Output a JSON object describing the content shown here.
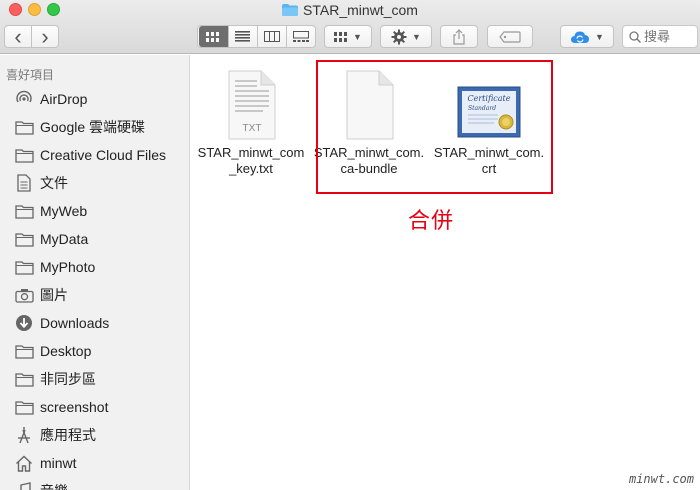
{
  "window": {
    "title": "STAR_minwt_com"
  },
  "toolbar": {
    "back_glyph": "‹",
    "forward_glyph": "›",
    "search_placeholder": "搜尋"
  },
  "sidebar": {
    "heading": "喜好項目",
    "items": [
      {
        "label": "AirDrop",
        "icon": "airdrop-icon"
      },
      {
        "label": "Google 雲端硬碟",
        "icon": "folder-icon"
      },
      {
        "label": "Creative Cloud Files",
        "icon": "folder-icon"
      },
      {
        "label": "文件",
        "icon": "documents-icon"
      },
      {
        "label": "MyWeb",
        "icon": "folder-icon"
      },
      {
        "label": "MyData",
        "icon": "folder-icon"
      },
      {
        "label": "MyPhoto",
        "icon": "folder-icon"
      },
      {
        "label": "圖片",
        "icon": "camera-icon"
      },
      {
        "label": "Downloads",
        "icon": "downloads-icon"
      },
      {
        "label": "Desktop",
        "icon": "folder-icon"
      },
      {
        "label": "非同步區",
        "icon": "folder-icon"
      },
      {
        "label": "screenshot",
        "icon": "folder-icon"
      },
      {
        "label": "應用程式",
        "icon": "applications-icon"
      },
      {
        "label": "minwt",
        "icon": "home-icon"
      },
      {
        "label": "音樂",
        "icon": "music-icon"
      }
    ]
  },
  "files": [
    {
      "name_line1": "STAR_minwt_com",
      "name_line2": "_key.txt",
      "icon": "txt-file-icon",
      "badge": "TXT"
    },
    {
      "name_line1": "STAR_minwt_com.",
      "name_line2": "ca-bundle",
      "icon": "blank-file-icon"
    },
    {
      "name_line1": "STAR_minwt_com.",
      "name_line2": "crt",
      "icon": "certificate-icon",
      "cert_text": "Certificate",
      "cert_sub": "Standard"
    }
  ],
  "annotation": {
    "text": "合併",
    "color": "#e60012"
  },
  "watermark": "minwt.com"
}
